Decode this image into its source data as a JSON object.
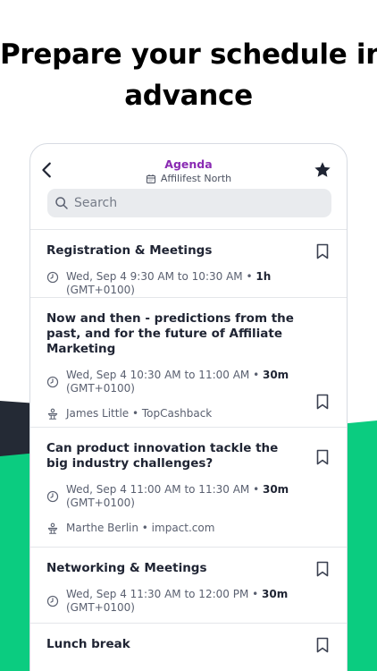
{
  "headline": {
    "line1": "Prepare your schedule in",
    "line2": "advance"
  },
  "header": {
    "title": "Agenda",
    "subtitle": "Affilifest North"
  },
  "search": {
    "placeholder": "Search"
  },
  "sessions": [
    {
      "title": "Registration & Meetings",
      "time": "Wed, Sep 4 9:30 AM to 10:30 AM",
      "duration": "1h",
      "tz": "(GMT+0100)",
      "speaker": ""
    },
    {
      "title": "Now and then - predictions from the past, and for the future of Affiliate Marketing",
      "time": "Wed, Sep 4 10:30 AM to 11:00 AM",
      "duration": "30m",
      "tz": "(GMT+0100)",
      "speaker": "James Little • TopCashback"
    },
    {
      "title": "Can product innovation tackle the big industry challenges?",
      "time": "Wed, Sep 4 11:00 AM to 11:30 AM",
      "duration": "30m",
      "tz": "(GMT+0100)",
      "speaker": "Marthe Berlin • impact.com"
    },
    {
      "title": "Networking & Meetings",
      "time": "Wed, Sep 4 11:30 AM to 12:00 PM",
      "duration": "30m",
      "tz": "(GMT+0100)",
      "speaker": ""
    },
    {
      "title": "Lunch break",
      "time": "",
      "duration": "",
      "tz": "",
      "speaker": ""
    }
  ],
  "colors": {
    "accent": "#8a2bb3",
    "green": "#0bcc80",
    "dark": "#242a35"
  }
}
